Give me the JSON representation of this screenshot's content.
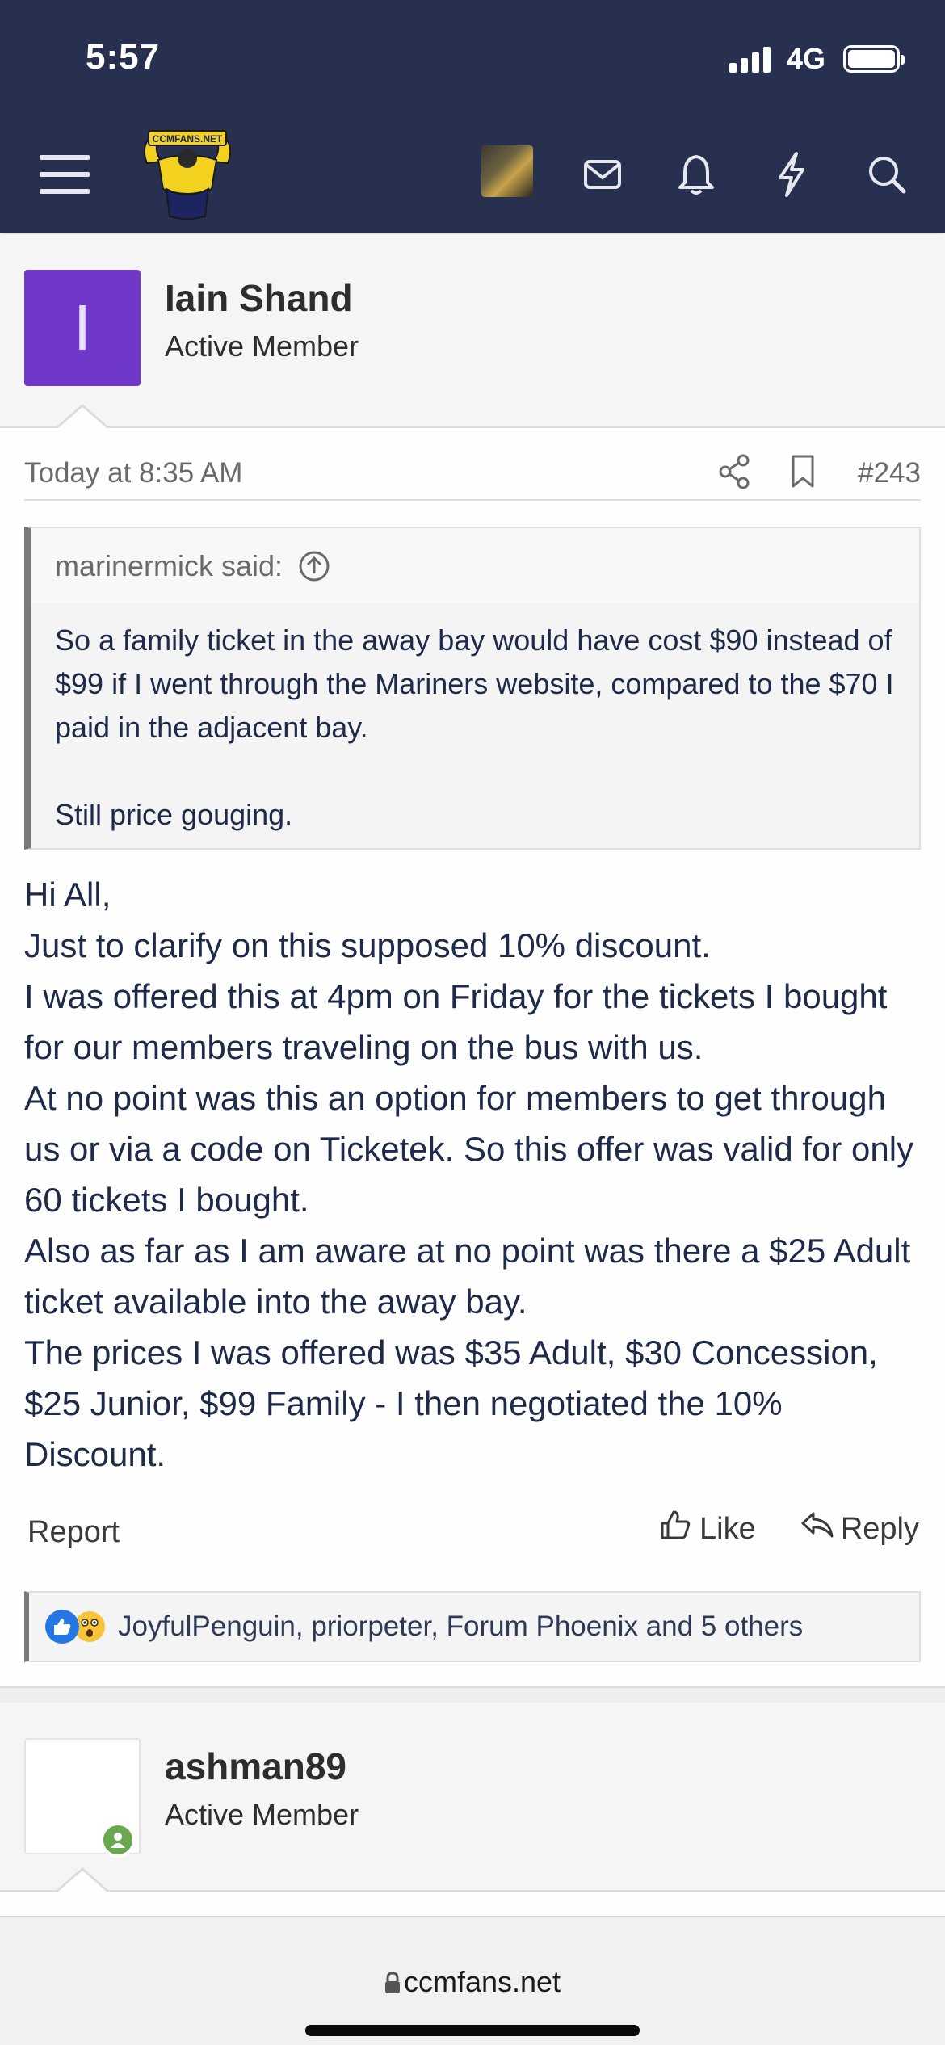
{
  "status_bar": {
    "time": "5:57",
    "network": "4G"
  },
  "navbar": {
    "logo_text": "CCMFANS.NET"
  },
  "post": {
    "author": {
      "initial": "I",
      "name": "Iain Shand",
      "title": "Active Member",
      "avatar_color": "#7038c8"
    },
    "date": "Today at 8:35 AM",
    "number": "#243",
    "quote": {
      "author": "marinermick said:",
      "paragraphs": [
        "So a family ticket in the away bay would have cost $90 instead of $99 if I went through the Mariners website, compared to the $70 I paid in the adjacent bay.",
        "Still price gouging."
      ]
    },
    "message_lines": [
      "Hi All,",
      "Just to clarify on this supposed 10% discount.",
      "I was offered this at 4pm on Friday for the tickets I bought for our members traveling on the bus with us.",
      "At no point was this an option for members to get through us or via a code on Ticketek. So this offer was valid for only 60 tickets I bought.",
      "Also as far as I am aware at no point was there a $25 Adult ticket available into the away bay.",
      "The prices I was offered was $35 Adult, $30 Concession, $25 Junior, $99 Family - I then negotiated the 10% Discount."
    ],
    "actions": {
      "report": "Report",
      "like": "Like",
      "reply": "Reply"
    },
    "reactions": {
      "text": "JoyfulPenguin, priorpeter, Forum Phoenix and 5 others"
    }
  },
  "next_post": {
    "author": {
      "name": "ashman89",
      "title": "Active Member"
    }
  },
  "browser": {
    "url": "ccmfans.net"
  },
  "colors": {
    "header_bg": "#283050",
    "text": "#1d2a4a",
    "accent_like": "#2577e3",
    "online": "#6aa84f"
  }
}
